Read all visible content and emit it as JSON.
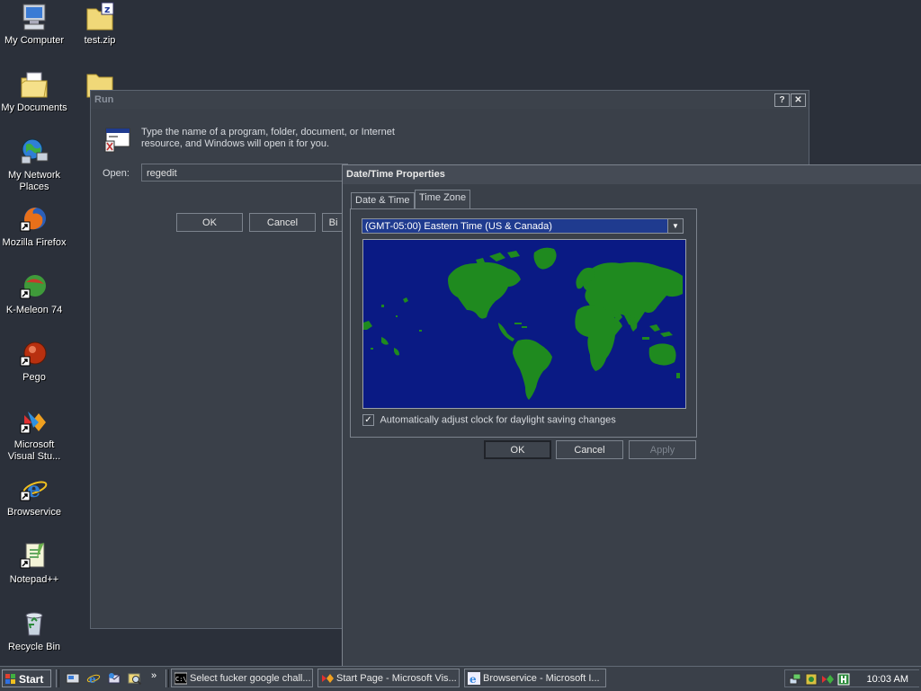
{
  "desktop": {
    "icons": [
      {
        "label": "My Computer"
      },
      {
        "label": "test.zip"
      },
      {
        "label": "My Documents"
      },
      {
        "label": "My Network Places"
      },
      {
        "label": "Mozilla Firefox"
      },
      {
        "label": "K-Meleon 74"
      },
      {
        "label": "Pego"
      },
      {
        "label": "Microsoft Visual Stu..."
      },
      {
        "label": "Browservice"
      },
      {
        "label": "Notepad++"
      },
      {
        "label": "Recycle Bin"
      }
    ]
  },
  "run_dialog": {
    "title": "Run",
    "help_button": "?",
    "close_button": "✕",
    "description": "Type the name of a program, folder, document, or Internet resource, and Windows will open it for you.",
    "open_label": "Open:",
    "open_value": "regedit",
    "ok_label": "OK",
    "cancel_label": "Cancel",
    "browse_label": "Bi"
  },
  "datetime_dialog": {
    "title": "Date/Time Properties",
    "tabs": [
      {
        "label": "Date & Time",
        "active": false
      },
      {
        "label": "Time Zone",
        "active": true
      }
    ],
    "timezone_value": "(GMT-05:00) Eastern Time (US & Canada)",
    "dst_label": "Automatically adjust clock for daylight saving changes",
    "dst_checked": true,
    "check_mark": "✓",
    "ok_label": "OK",
    "cancel_label": "Cancel",
    "apply_label": "Apply"
  },
  "taskbar": {
    "start_label": "Start",
    "chevron": "»",
    "tasks": [
      {
        "label": "Select fucker google chall..."
      },
      {
        "label": "Start Page - Microsoft Vis..."
      },
      {
        "label": "Browservice - Microsoft I..."
      }
    ],
    "clock": "10:03 AM"
  },
  "colors": {
    "desktop_bg": "#2b303a",
    "selection_blue": "#1f3b8f",
    "map_ocean": "#0a1a84",
    "map_land": "#1f8a1f"
  }
}
